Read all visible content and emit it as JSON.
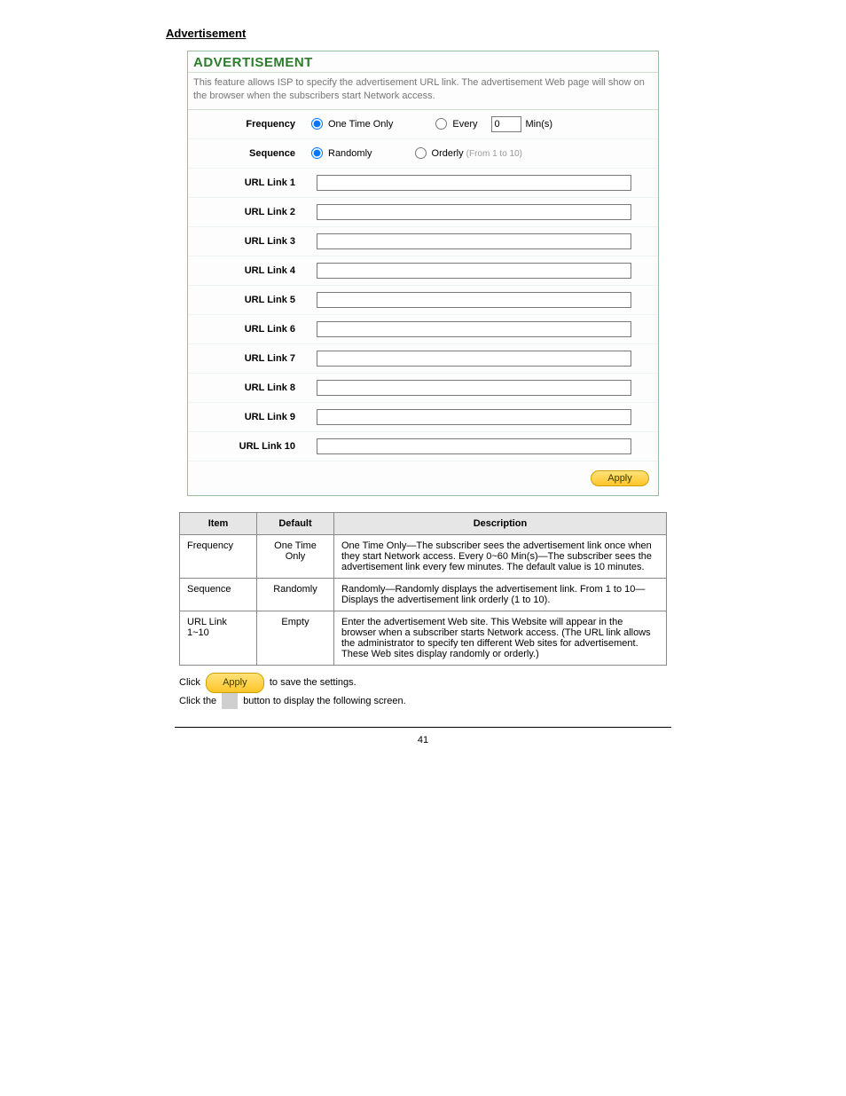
{
  "section_heading": "Advertisement",
  "adv": {
    "title": "ADVERTISEMENT",
    "desc": "This feature allows ISP to specify the advertisement URL link. The advertisement Web page will show on the browser when the subscribers start Network access.",
    "rows": {
      "frequency_label": "Frequency",
      "one_time_only": "One Time Only",
      "every": "Every",
      "every_value": "0",
      "mins": "Min(s)",
      "sequence_label": "Sequence",
      "randomly": "Randomly",
      "orderly": "Orderly",
      "orderly_note": "(From 1 to 10)"
    },
    "urls": [
      {
        "label": "URL Link 1",
        "value": ""
      },
      {
        "label": "URL Link 2",
        "value": ""
      },
      {
        "label": "URL Link 3",
        "value": ""
      },
      {
        "label": "URL Link 4",
        "value": ""
      },
      {
        "label": "URL Link 5",
        "value": ""
      },
      {
        "label": "URL Link 6",
        "value": ""
      },
      {
        "label": "URL Link 7",
        "value": ""
      },
      {
        "label": "URL Link 8",
        "value": ""
      },
      {
        "label": "URL Link 9",
        "value": ""
      },
      {
        "label": "URL Link 10",
        "value": ""
      }
    ],
    "apply": "Apply"
  },
  "desc_table": {
    "headers": {
      "item": "Item",
      "default": "Default",
      "description": "Description"
    },
    "rows": [
      {
        "item": "Frequency",
        "default": "One Time Only",
        "description": "One Time Only—The subscriber sees the advertisement link once when they start Network access. Every 0~60 Min(s)—The subscriber sees the advertisement link every few minutes. The default value is 10 minutes."
      },
      {
        "item": "Sequence",
        "default": "Randomly",
        "description": "Randomly—Randomly displays the advertisement link. From 1 to 10—Displays the advertisement link orderly (1 to 10)."
      },
      {
        "item": "URL Link 1~10",
        "default": "Empty",
        "description": "Enter the advertisement Web site. This Website will appear in the browser when a subscriber starts Network access. (The URL link allows the administrator to specify ten different Web sites for advertisement. These Web sites display randomly or orderly.)"
      }
    ]
  },
  "below_text": {
    "line1_prefix": "Click",
    "apply": "Apply",
    "line1_suffix": "to save the settings.",
    "line2_prefix": "Click the",
    "line2_suffix": "button to display the following screen."
  },
  "footer": "41"
}
